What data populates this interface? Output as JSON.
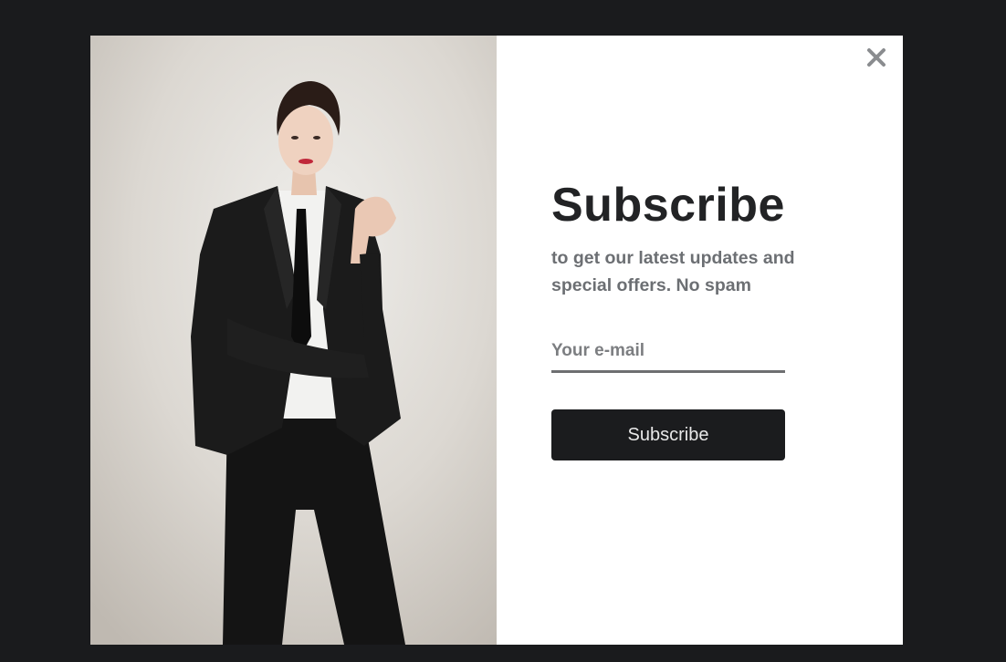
{
  "popup": {
    "title": "Subscribe",
    "subtitle": "to get our latest updates and special offers. No spam",
    "email_placeholder": "Your e-mail",
    "email_value": "",
    "button_label": "Subscribe",
    "close_icon": "close-icon",
    "close_glyph": "✕",
    "photo_description_icon": "promo-photo"
  },
  "colors": {
    "backdrop": "#1a1b1d",
    "title": "#222325",
    "subtitle": "#6c6f73",
    "button_bg": "#1b1c1e",
    "button_text": "#e8e8e8",
    "input_underline": "#6e6f71"
  }
}
